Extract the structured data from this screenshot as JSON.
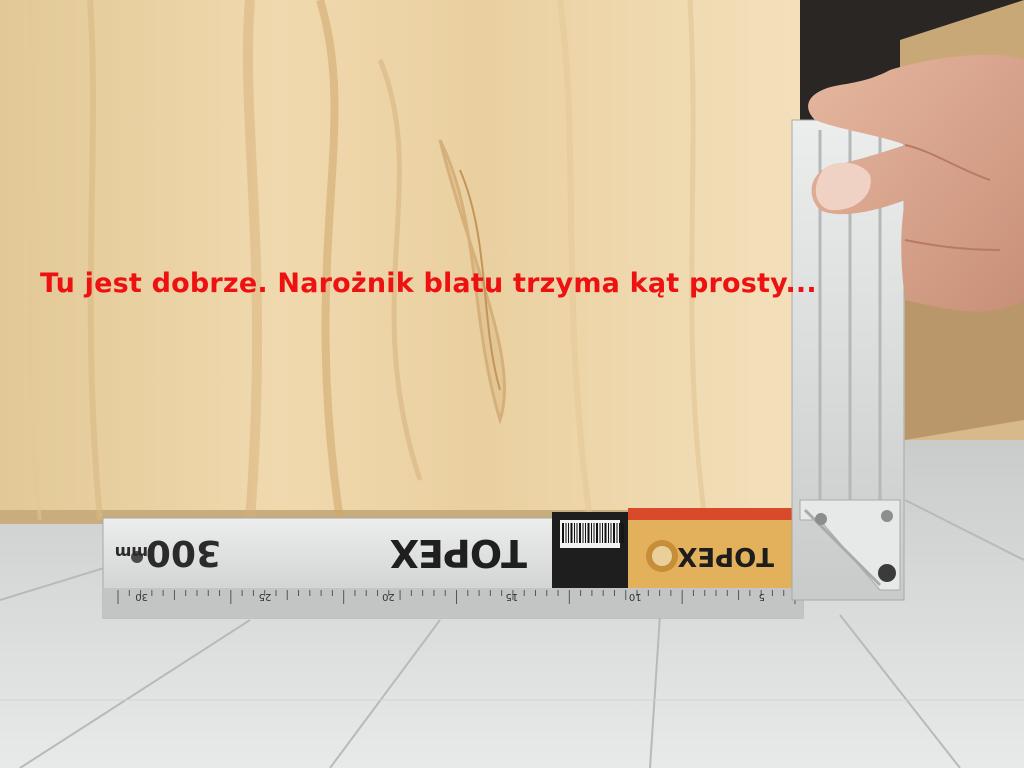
{
  "caption": "Tu jest dobrze. Narożnik blatu trzyma kąt prosty...",
  "ruler": {
    "brand": "TOPEX",
    "size_label": "300",
    "unit_label": "mm",
    "scale_marks": [
      "30",
      "25",
      "20",
      "15",
      "10",
      "5"
    ]
  },
  "colors": {
    "caption": "#ee1111",
    "wood": "#ecd3a6",
    "ruler": "#d8dad8",
    "floor": "#dcdedd"
  }
}
